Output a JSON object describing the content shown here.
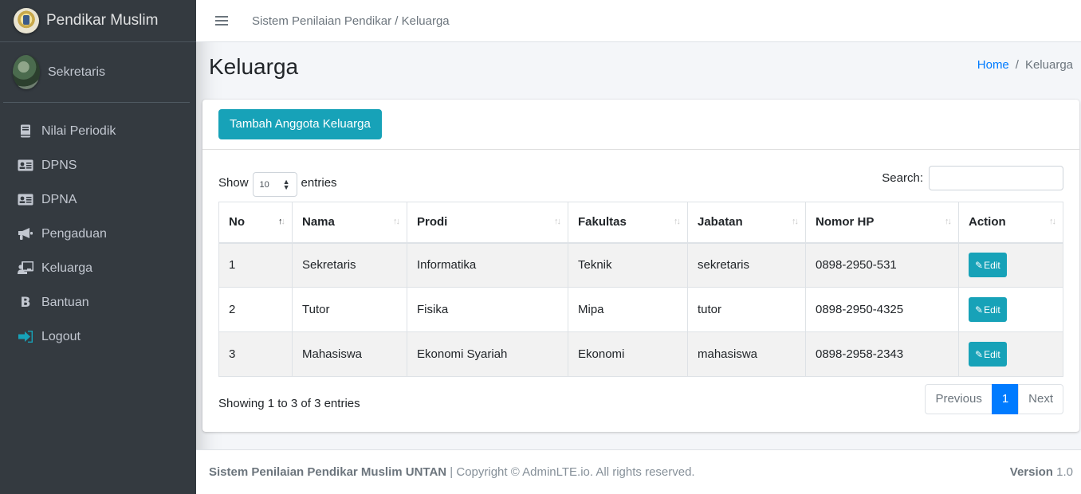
{
  "brand": {
    "name": "Pendikar Muslim"
  },
  "user": {
    "name": "Sekretaris"
  },
  "sidebar": {
    "items": [
      {
        "label": "Nilai Periodik",
        "icon": "book-icon"
      },
      {
        "label": "DPNS",
        "icon": "id-card-icon"
      },
      {
        "label": "DPNA",
        "icon": "id-card-icon"
      },
      {
        "label": "Pengaduan",
        "icon": "bullhorn-icon"
      },
      {
        "label": "Keluarga",
        "icon": "chalkboard-teacher-icon"
      },
      {
        "label": "Bantuan",
        "icon": "bold-b-icon"
      },
      {
        "label": "Logout",
        "icon": "sign-out-icon"
      }
    ]
  },
  "topbar": {
    "title": "Sistem Penilaian Pendikar / Keluarga"
  },
  "page": {
    "title": "Keluarga"
  },
  "breadcrumb": {
    "home": "Home",
    "separator": "/",
    "current": "Keluarga"
  },
  "card": {
    "add_button": "Tambah Anggota Keluarga"
  },
  "datatable": {
    "show_label": "Show",
    "entries_value": "10",
    "entries_label": "entries",
    "search_label": "Search:",
    "search_value": "",
    "columns": [
      "No",
      "Nama",
      "Prodi",
      "Fakultas",
      "Jabatan",
      "Nomor HP",
      "Action"
    ],
    "rows": [
      {
        "no": "1",
        "nama": "Sekretaris",
        "prodi": "Informatika",
        "fakultas": "Teknik",
        "jabatan": "sekretaris",
        "hp": "0898-2950-531",
        "action": "Edit"
      },
      {
        "no": "2",
        "nama": "Tutor",
        "prodi": "Fisika",
        "fakultas": "Mipa",
        "jabatan": "tutor",
        "hp": "0898-2950-4325",
        "action": "Edit"
      },
      {
        "no": "3",
        "nama": "Mahasiswa",
        "prodi": "Ekonomi Syariah",
        "fakultas": "Ekonomi",
        "jabatan": "mahasiswa",
        "hp": "0898-2958-2343",
        "action": "Edit"
      }
    ],
    "info": "Showing 1 to 3 of 3 entries",
    "pagination": {
      "previous": "Previous",
      "current": "1",
      "next": "Next"
    }
  },
  "footer": {
    "strong": "Sistem Penilaian Pendikar Muslim UNTAN",
    "rest": " | Copyright © AdminLTE.io. All rights reserved.",
    "version_label": "Version",
    "version_value": "1.0"
  },
  "colors": {
    "sidebar": "#343a40",
    "accent": "#17a2b8",
    "primary": "#007bff"
  }
}
